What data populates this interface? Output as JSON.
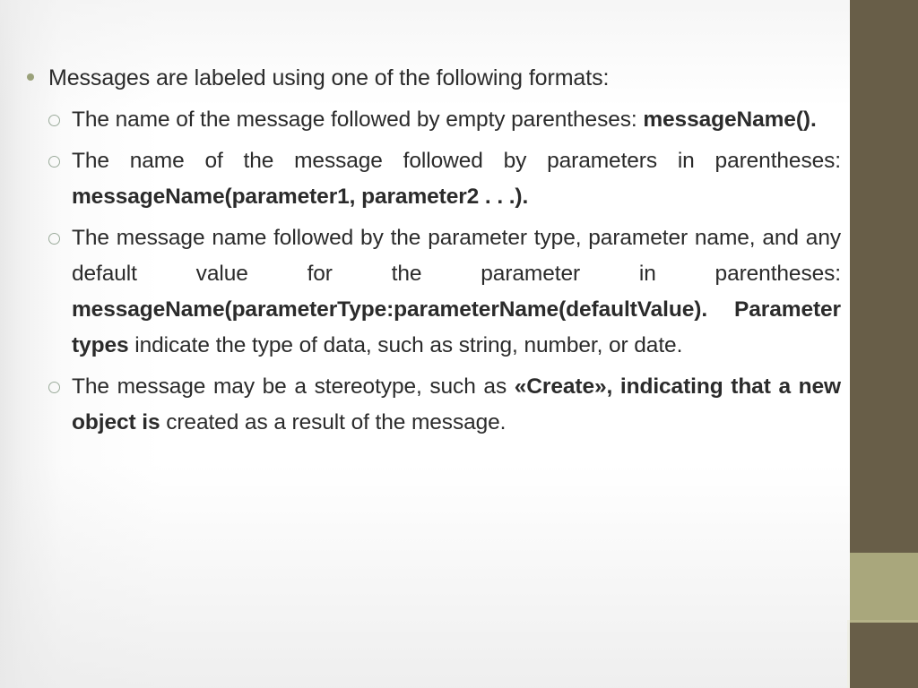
{
  "slide": {
    "main_bullet": "Messages are labeled using one of the following formats:",
    "sub_bullets": [
      {
        "lead": "The name of the message followed by empty parentheses:",
        "bold": "messageName().",
        "tail": ""
      },
      {
        "lead": " The name of the message followed by parameters in parentheses:",
        "bold": "messageName(parameter1, parameter2 . . .).",
        "tail": ""
      },
      {
        "lead": "The message name followed by the parameter type, parameter name, and any default value for the parameter in parentheses:",
        "bold": "messageName(parameterType:parameterName(defaultValue).",
        "bold2": "Parameter types",
        "tail": " indicate the type of data, such as string, number, or date."
      },
      {
        "lead": "The message may be a stereotype, such as ",
        "bold": "«Create», indicating that a new object is",
        "tail": " created as a result of the message."
      }
    ]
  },
  "colors": {
    "text": "#2b2b2b",
    "bullet_dot": "#9aa17a",
    "bullet_ring": "#9bab9b",
    "sidebar_dark": "#685e48",
    "sidebar_light": "#a9a77c",
    "background": "#ffffff"
  }
}
